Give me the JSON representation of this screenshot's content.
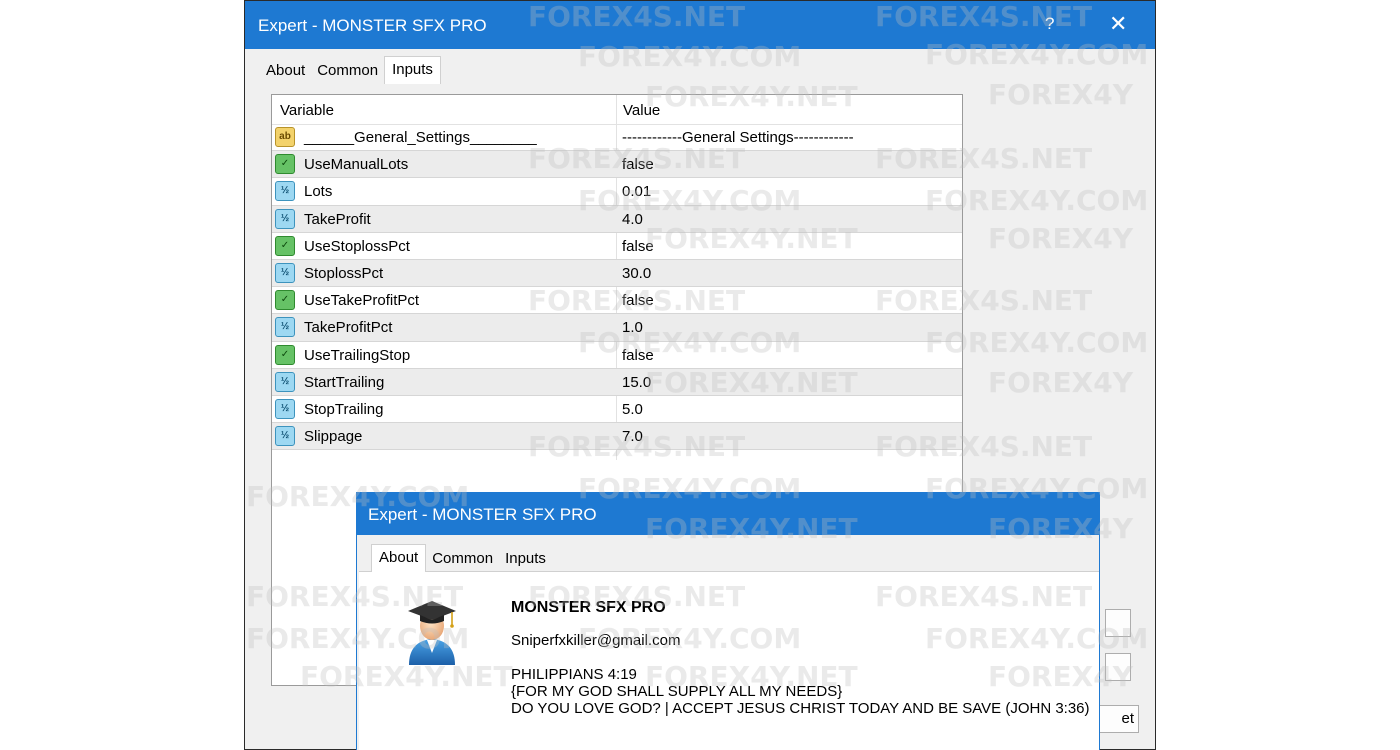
{
  "main_window": {
    "title": "Expert - MONSTER SFX PRO",
    "help": "?",
    "close": "✕",
    "tabs": [
      "About",
      "Common",
      "Inputs"
    ],
    "active_tab": "Inputs",
    "table": {
      "headers": {
        "variable": "Variable",
        "value": "Value"
      },
      "rows": [
        {
          "type": "string",
          "icon": "ab",
          "variable": "______General_Settings________",
          "value": "------------General Settings------------"
        },
        {
          "type": "bool",
          "icon": "✓",
          "variable": "UseManualLots",
          "value": "false"
        },
        {
          "type": "number",
          "icon": "½",
          "variable": "Lots",
          "value": "0.01"
        },
        {
          "type": "number",
          "icon": "½",
          "variable": "TakeProfit",
          "value": "4.0"
        },
        {
          "type": "bool",
          "icon": "✓",
          "variable": "UseStoplossPct",
          "value": "false"
        },
        {
          "type": "number",
          "icon": "½",
          "variable": "StoplossPct",
          "value": "30.0"
        },
        {
          "type": "bool",
          "icon": "✓",
          "variable": "UseTakeProfitPct",
          "value": "false"
        },
        {
          "type": "number",
          "icon": "½",
          "variable": "TakeProfitPct",
          "value": "1.0"
        },
        {
          "type": "bool",
          "icon": "✓",
          "variable": "UseTrailingStop",
          "value": "false"
        },
        {
          "type": "number",
          "icon": "½",
          "variable": "StartTrailing",
          "value": "15.0"
        },
        {
          "type": "number",
          "icon": "½",
          "variable": "StopTrailing",
          "value": "5.0"
        },
        {
          "type": "number",
          "icon": "½",
          "variable": "Slippage",
          "value": "7.0"
        }
      ]
    },
    "partial_button_text": "et"
  },
  "about_window": {
    "title": "Expert - MONSTER SFX PRO",
    "tabs": [
      "About",
      "Common",
      "Inputs"
    ],
    "active_tab": "About",
    "name": "MONSTER SFX PRO",
    "email": "Sniperfxkiller@gmail.com",
    "description": [
      "PHILIPPIANS 4:19",
      "{FOR MY GOD SHALL SUPPLY ALL MY NEEDS}",
      "DO YOU LOVE GOD? | ACCEPT JESUS CHRIST TODAY AND BE SAVE (JOHN 3:36)"
    ]
  },
  "watermarks": [
    "FOREX4S.NET",
    "FOREX4Y.COM",
    "FOREX4Y.NET",
    "FOREX4Y"
  ],
  "colors": {
    "titlebar": "#1e79d2",
    "string_icon": "#f3d26b",
    "bool_icon": "#66c266",
    "number_icon": "#9dd8f2"
  }
}
